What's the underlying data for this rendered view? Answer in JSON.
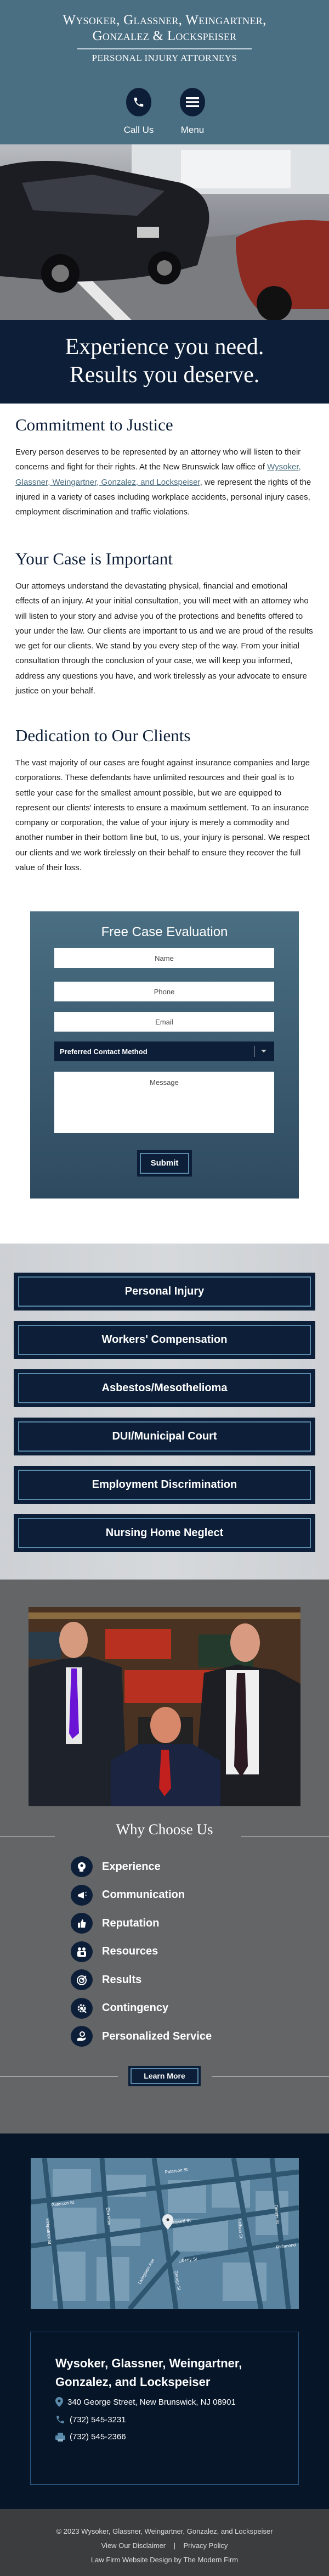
{
  "header": {
    "firm_line1": "Wysoker, Glassner, Weingartner,",
    "firm_line2": "Gonzalez & Lockspeiser",
    "tagline": "PERSONAL INJURY ATTORNEYS",
    "call_label": "Call Us",
    "menu_label": "Menu"
  },
  "banner": {
    "line1": "Experience you need.",
    "line2": "Results you deserve."
  },
  "sections": [
    {
      "title": "Commitment to Justice",
      "text_before": "Every person deserves to be represented by an attorney who will listen to their concerns and fight for their rights. At the New Brunswick law office of ",
      "link": "Wysoker, Glassner, Weingartner, Gonzalez, and Lockspeiser",
      "text_after": ", we represent the rights of the injured in a variety of cases including workplace accidents, personal injury cases, employment discrimination and traffic violations."
    },
    {
      "title": "Your Case is Important",
      "text": "Our attorneys understand the devastating physical, financial and emotional effects of an injury. At your initial consultation, you will meet with an attorney who will listen to your story and advise you of the protections and benefits offered to your under the law. Our clients are important to us and we are proud of the results we get for our clients. We stand by you every step of the way. From your initial consultation through the conclusion of your case, we will keep you informed, address any questions you have, and work tirelessly as your advocate to ensure justice on your behalf."
    },
    {
      "title": "Dedication to Our Clients",
      "text": "The vast majority of our cases are fought against insurance companies and large corporations. These defendants have unlimited resources and their goal is to settle your case for the smallest amount possible, but we are equipped to represent our clients' interests to ensure a maximum settlement. To an insurance company or corporation, the value of your injury is merely a commodity and another number in their bottom line but, to us, your injury is personal. We respect our clients and we work tirelessly on their behalf to ensure they recover the full value of their loss."
    }
  ],
  "form": {
    "title": "Free Case Evaluation",
    "name_placeholder": "Name",
    "phone_placeholder": "Phone",
    "email_placeholder": "Email",
    "contact_method": "Preferred Contact Method",
    "message_placeholder": "Message",
    "submit": "Submit"
  },
  "practice_areas": [
    "Personal Injury",
    "Workers' Compensation",
    "Asbestos/Mesothelioma",
    "DUI/Municipal Court",
    "Employment Discrimination",
    "Nursing Home Neglect"
  ],
  "why": {
    "title": "Why Choose Us",
    "items": [
      {
        "label": "Experience",
        "icon": "head-gear-icon"
      },
      {
        "label": "Communication",
        "icon": "megaphone-icon"
      },
      {
        "label": "Reputation",
        "icon": "thumbs-up-icon"
      },
      {
        "label": "Resources",
        "icon": "people-icon"
      },
      {
        "label": "Results",
        "icon": "target-icon"
      },
      {
        "label": "Contingency",
        "icon": "gear-icon"
      },
      {
        "label": "Personalized Service",
        "icon": "hand-person-icon"
      }
    ],
    "learn_more": "Learn More"
  },
  "map": {
    "streets": [
      "Paterson St",
      "Paterson St",
      "Bayard St",
      "Liberty St",
      "George St",
      "Livingston Ave",
      "Elm Row",
      "Kirkpatrick St",
      "Neilson St",
      "Dennis St",
      "Richmond"
    ]
  },
  "address": {
    "name_line1": "Wysoker, Glassner, Weingartner,",
    "name_line2": "Gonzalez, and Lockspeiser",
    "street": "340 George Street, New Brunswick, NJ 08901",
    "phone": "(732) 545-3231",
    "fax": "(732) 545-2366"
  },
  "footer": {
    "copyright": "© 2023 Wysoker, Glassner, Weingartner, Gonzalez, and Lockspeiser",
    "disclaimer": "View Our Disclaimer",
    "separator": "|",
    "privacy": "Privacy Policy",
    "credit": "Law Firm Website Design by The Modern Firm"
  },
  "colors": {
    "header": "#4a6e82",
    "navy": "#0d1f38",
    "accent": "#5a8aaa",
    "gray_section": "#646567",
    "footer": "#3c3d3e"
  }
}
